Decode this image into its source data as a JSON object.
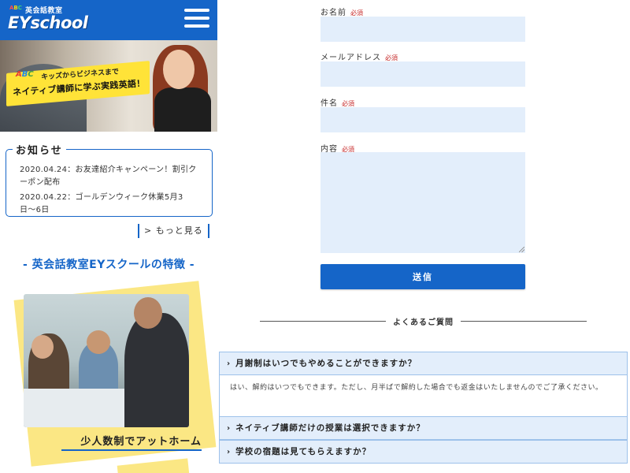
{
  "header": {
    "logo_sub": "英会話教室",
    "logo_abc": [
      "A",
      "B",
      "C"
    ],
    "logo_main": "EYschool",
    "menu_icon": "hamburger-menu-icon"
  },
  "hero": {
    "abc": [
      "A",
      "B",
      "C"
    ],
    "line1": "キッズからビジネスまで",
    "line2": "ネイティブ講師に学ぶ実践英語！"
  },
  "news": {
    "title": "お知らせ",
    "items": [
      "2020.04.24：お友達紹介キャンペーン！割引クーポン配布",
      "2020.04.22：ゴールデンウィーク休業5月3日〜6日"
    ],
    "more": "> もっと見る"
  },
  "features": {
    "title": "- 英会話教室EYスクールの特徴 -",
    "caption": "少人数制でアットホーム"
  },
  "form": {
    "required": "必須",
    "name_label": "お名前",
    "email_label": "メールアドレス",
    "subject_label": "件名",
    "content_label": "内容",
    "submit": "送信"
  },
  "faq": {
    "heading": "よくあるご質問",
    "items": [
      {
        "q": "月謝制はいつでもやめることができますか？",
        "a": "はい、解約はいつでもできます。ただし、月半ばで解約した場合でも返金はいたしませんのでご了承ください。"
      },
      {
        "q": "ネイティブ講師だけの授業は選択できますか？"
      },
      {
        "q": "学校の宿題は見てもらえますか？"
      }
    ]
  },
  "colors": {
    "brand_blue": "#1565c8",
    "field_bg": "#e3eefb",
    "accent_yellow": "#fbe784",
    "required_red": "#c62828"
  }
}
